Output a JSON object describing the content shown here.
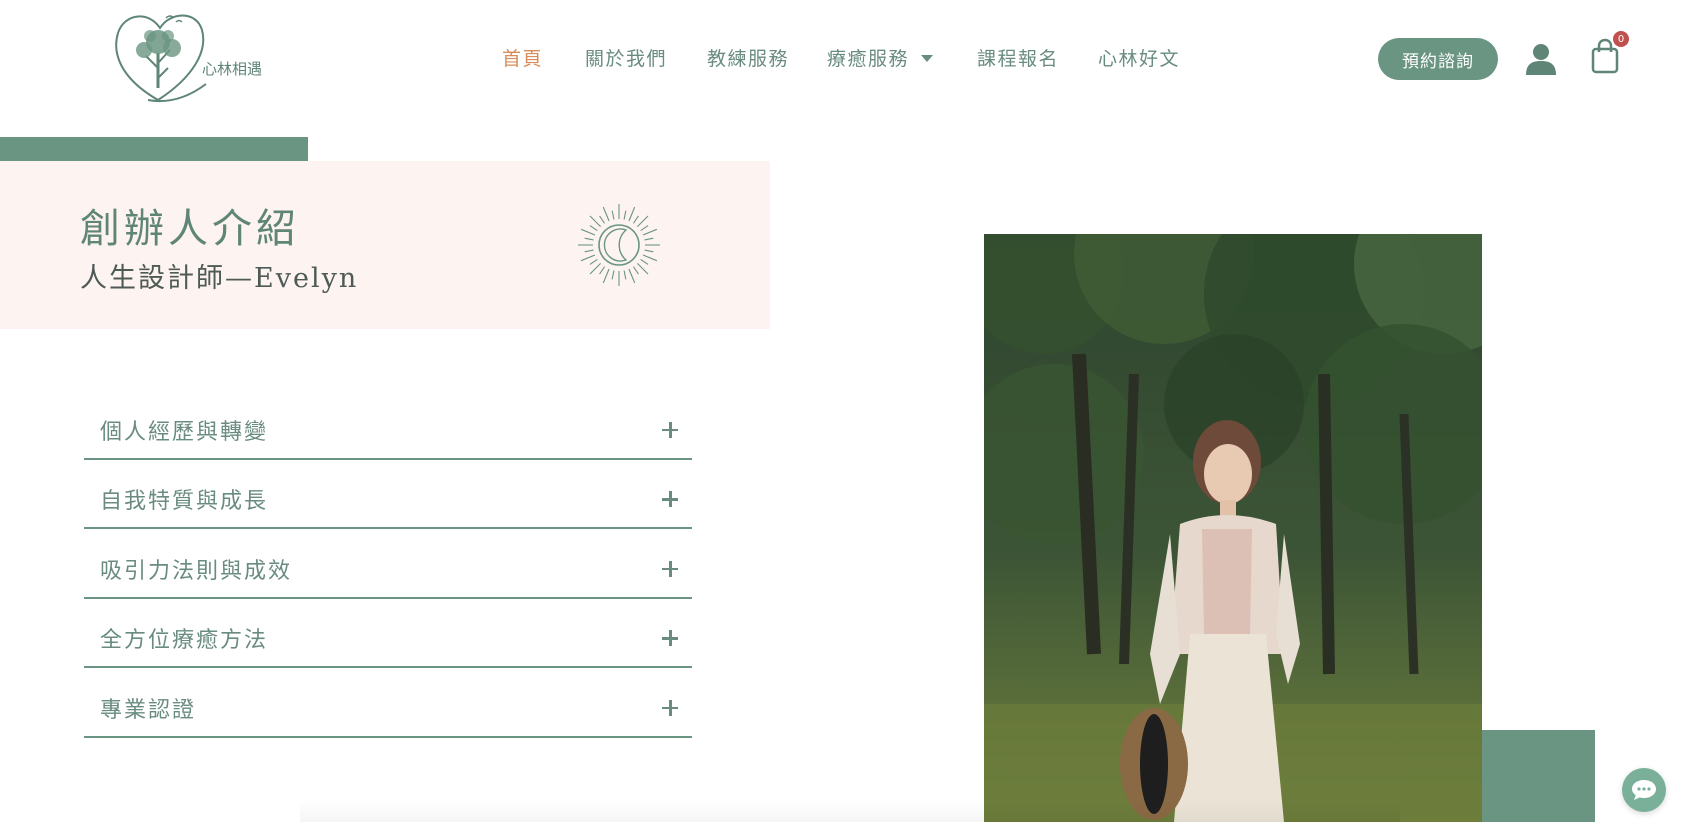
{
  "brand": {
    "logo_text": "心林相遇",
    "accent_color": "#6a9582",
    "active_nav_color": "#d98c5a"
  },
  "nav": {
    "items": [
      {
        "label": "首頁"
      },
      {
        "label": "關於我們"
      },
      {
        "label": "教練服務"
      },
      {
        "label": "療癒服務"
      },
      {
        "label": "課程報名"
      },
      {
        "label": "心林好文"
      }
    ],
    "cta_label": "預約諮詢",
    "cart_count": "0"
  },
  "hero": {
    "title": "創辦人介紹",
    "subtitle": "人生設計師—Evelyn"
  },
  "accordion": {
    "items": [
      {
        "label": "個人經歷與轉變"
      },
      {
        "label": "自我特質與成長"
      },
      {
        "label": "吸引力法則與成效"
      },
      {
        "label": "全方位療癒方法"
      },
      {
        "label": "專業認證"
      }
    ]
  },
  "icons": {
    "user": "user-icon",
    "cart": "shopping-bag-icon",
    "chat": "chat-bubble-icon",
    "plus": "plus-icon",
    "sun_moon": "sun-moon-icon"
  }
}
